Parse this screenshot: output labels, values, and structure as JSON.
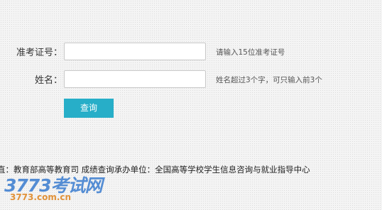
{
  "form": {
    "exam_id": {
      "label": "准考证号：",
      "value": "",
      "placeholder": "",
      "hint": "请输入15位准考证号"
    },
    "name": {
      "label": "姓名：",
      "value": "",
      "placeholder": "",
      "hint": "姓名超过3个字，可只输入前3个"
    },
    "submit_label": "查询"
  },
  "footer": {
    "text": "直：教育部高等教育司    成绩查询承办单位：全国高等学校学生信息咨询与就业指导中心"
  },
  "watermark": {
    "main": "3773考试网",
    "sub": "3773.com.cn"
  },
  "colors": {
    "button": "#27aec8",
    "watermark_main": "#3f7fd0",
    "watermark_sub": "#e08a2a"
  }
}
